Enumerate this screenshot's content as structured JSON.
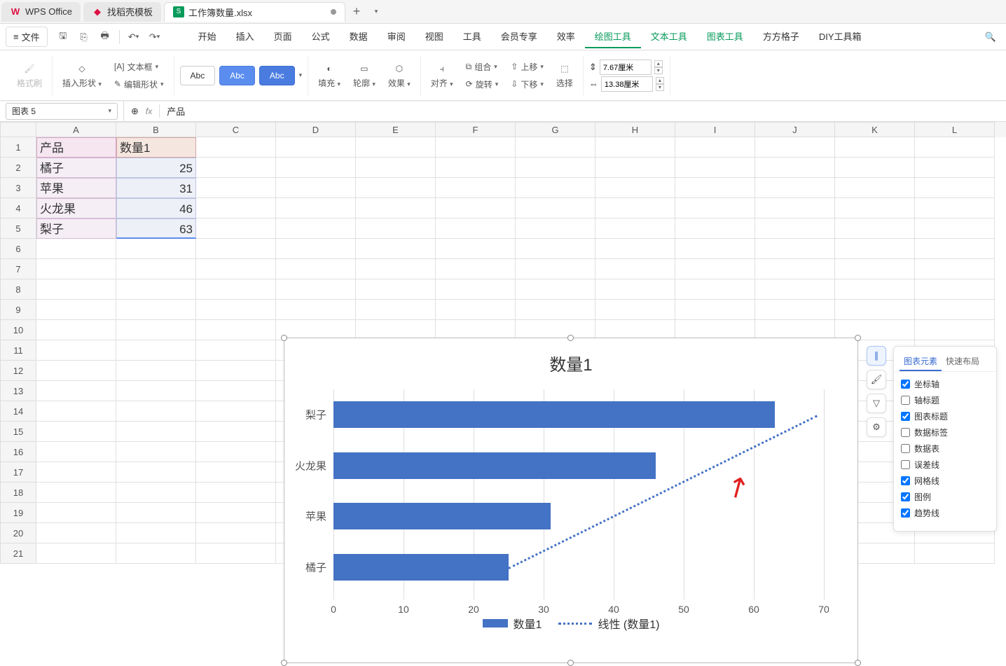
{
  "tabs": {
    "office": "WPS Office",
    "template": "找稻壳模板",
    "workbook": "工作簿数量.xlsx"
  },
  "menu": {
    "file": "文件",
    "items": [
      "开始",
      "插入",
      "页面",
      "公式",
      "数据",
      "审阅",
      "视图",
      "工具",
      "会员专享",
      "效率",
      "绘图工具",
      "文本工具",
      "图表工具",
      "方方格子",
      "DIY工具箱"
    ],
    "active_index": 10,
    "highlight_indices": [
      10,
      11,
      12
    ]
  },
  "ribbon": {
    "format_brush": "格式刷",
    "insert_shape": "插入形状",
    "textbox": "文本框",
    "edit_shape": "编辑形状",
    "abc": "Abc",
    "fill": "填充",
    "outline": "轮廓",
    "effect": "效果",
    "align": "对齐",
    "group": "组合",
    "rotate": "旋转",
    "move_up": "上移",
    "move_down": "下移",
    "select": "选择",
    "height": "7.67厘米",
    "width": "13.38厘米"
  },
  "formula_bar": {
    "name_box": "图表 5",
    "fx": "fx",
    "content": "产品"
  },
  "sheet": {
    "col_headers": [
      "A",
      "B",
      "C",
      "D",
      "E",
      "F",
      "G",
      "H",
      "I",
      "J",
      "K",
      "L"
    ],
    "row_headers": [
      "1",
      "2",
      "3",
      "4",
      "5",
      "6",
      "7",
      "8",
      "9",
      "10",
      "11",
      "12",
      "13",
      "14",
      "15",
      "16",
      "17",
      "18",
      "19",
      "20",
      "21"
    ],
    "header_row": [
      "产品",
      "数量1"
    ],
    "data_rows": [
      [
        "橘子",
        "25"
      ],
      [
        "苹果",
        "31"
      ],
      [
        "火龙果",
        "46"
      ],
      [
        "梨子",
        "63"
      ]
    ]
  },
  "chart_data": {
    "type": "bar",
    "title": "数量1",
    "categories": [
      "梨子",
      "火龙果",
      "苹果",
      "橘子"
    ],
    "values": [
      63,
      46,
      31,
      25
    ],
    "xlabel": "",
    "ylabel": "",
    "x_ticks": [
      0,
      10,
      20,
      30,
      40,
      50,
      60,
      70
    ],
    "xlim": [
      0,
      70
    ],
    "legend": [
      "数量1",
      "线性 (数量1)"
    ],
    "trendline": {
      "type": "linear",
      "series": "数量1",
      "style": "dotted"
    },
    "grid": true
  },
  "elements_panel": {
    "tabs": [
      "图表元素",
      "快速布局"
    ],
    "active_tab": 0,
    "items": [
      {
        "label": "坐标轴",
        "checked": true
      },
      {
        "label": "轴标题",
        "checked": false
      },
      {
        "label": "图表标题",
        "checked": true
      },
      {
        "label": "数据标签",
        "checked": false
      },
      {
        "label": "数据表",
        "checked": false
      },
      {
        "label": "误差线",
        "checked": false
      },
      {
        "label": "网格线",
        "checked": true
      },
      {
        "label": "图例",
        "checked": true
      },
      {
        "label": "趋势线",
        "checked": true
      }
    ]
  }
}
